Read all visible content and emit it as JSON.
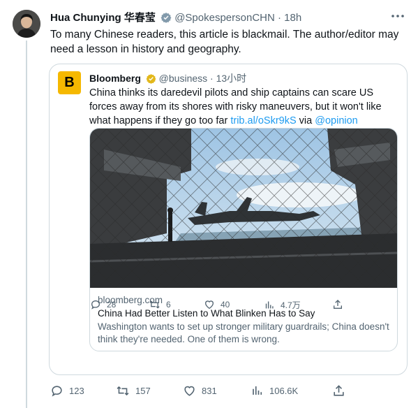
{
  "tweet": {
    "author_name": "Hua Chunying",
    "author_name_cn": "华春莹",
    "handle": "@SpokespersonCHN",
    "separator": "·",
    "time": "18h",
    "text": "To many Chinese readers, this article is blackmail. The author/editor may need a lesson in history and geography.",
    "stats": {
      "replies": "123",
      "retweets": "157",
      "likes": "831",
      "views": "106.6K"
    }
  },
  "quoted": {
    "avatar_letter": "B",
    "author_name": "Bloomberg",
    "handle": "@business",
    "separator": "·",
    "time": "13小时",
    "text": "China thinks its daredevil pilots and ship captains can scare US forces away from its shores with risky maneuvers, but it won't like what happens if they go too far",
    "link": "trib.al/oSkr9kS",
    "via": "via",
    "mention": "@opinion",
    "card": {
      "domain": "bloomberg.com",
      "title": "China Had Better Listen to What Blinken Has to Say",
      "description": "Washington wants to set up stronger military guardrails; China doesn't think they're needed. One of them is wrong."
    },
    "stats": {
      "replies": "28",
      "retweets": "6",
      "likes": "40",
      "views": "4.7万"
    }
  },
  "colors": {
    "accent": "#1d9bf0",
    "muted": "#536471",
    "bloomberg_badge": "#f5b800",
    "border": "#cfd9de"
  }
}
